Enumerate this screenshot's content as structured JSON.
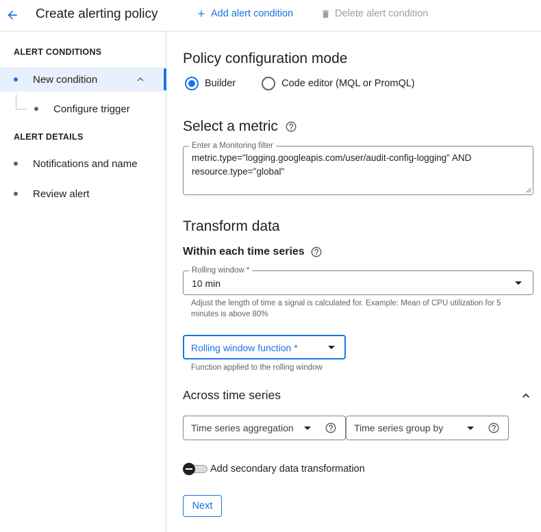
{
  "header": {
    "title": "Create alerting policy",
    "add_condition": "Add alert condition",
    "delete_condition": "Delete alert condition"
  },
  "sidebar": {
    "section_conditions": "ALERT CONDITIONS",
    "new_condition": "New condition",
    "configure_trigger": "Configure trigger",
    "section_details": "ALERT DETAILS",
    "notifications": "Notifications and name",
    "review": "Review alert"
  },
  "main": {
    "mode_title": "Policy configuration mode",
    "mode_options": [
      "Builder",
      "Code editor (MQL or PromQL)"
    ],
    "mode_selected": "Builder",
    "metric_title": "Select a metric",
    "filter_legend": "Enter a Monitoring filter",
    "filter_value": "metric.type=\"logging.googleapis.com/user/audit-config-logging\" AND resource.type=\"global\"",
    "transform_title": "Transform data",
    "within_title": "Within each time series",
    "rolling_window_legend": "Rolling window *",
    "rolling_window_value": "10 min",
    "rolling_window_hint": "Adjust the length of time a signal is calculated for. Example: Mean of CPU utilization for 5 minutes is above 80%",
    "rolling_fn_label": "Rolling window function *",
    "rolling_fn_hint": "Function applied to the rolling window",
    "across_title": "Across time series",
    "aggregation_label": "Time series aggregation",
    "group_by_label": "Time series group by",
    "secondary_toggle_label": "Add secondary data transformation",
    "secondary_toggle_on": false,
    "next_label": "Next"
  },
  "colors": {
    "accent": "#1a73e8",
    "text": "#202124",
    "muted": "#5f6368",
    "active_bg": "#e8f0fe",
    "border": "#dadce0"
  }
}
